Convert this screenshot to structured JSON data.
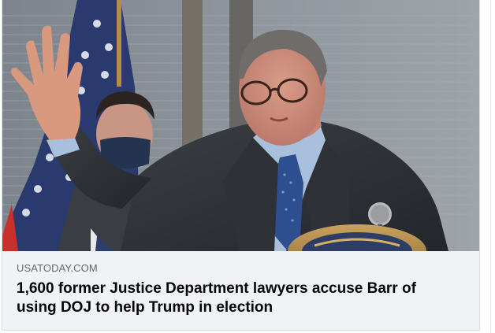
{
  "link_preview": {
    "image_alt": "",
    "domain": "USATODAY.COM",
    "headline": "1,600 former Justice Department lawyers accuse Barr of using DOJ to help Trump in election"
  },
  "colors": {
    "footer_background": "#f0f2f5",
    "domain_text": "#65676b",
    "headline_text": "#050505",
    "border": "#dadde1"
  }
}
